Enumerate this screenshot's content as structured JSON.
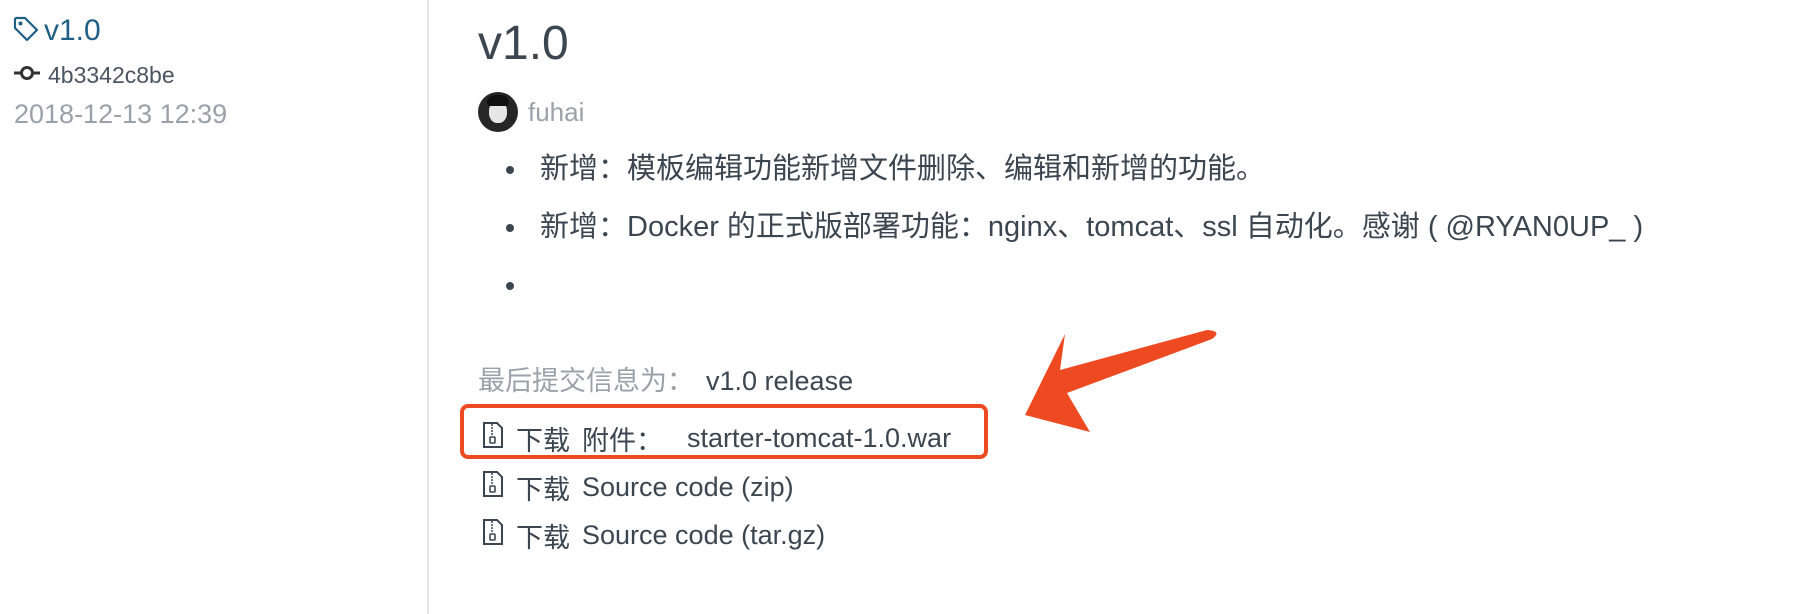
{
  "sidebar": {
    "tag": "v1.0",
    "commit_sha": "4b3342c8be",
    "date": "2018-12-13 12:39"
  },
  "release": {
    "title": "v1.0",
    "author": "fuhai",
    "notes": [
      "新增：模板编辑功能新增文件删除、编辑和新增的功能。",
      "新增：Docker 的正式版部署功能：nginx、tomcat、ssl 自动化。感谢 ( @RYAN0UP_ )",
      ""
    ],
    "last_commit_label": "最后提交信息为：",
    "last_commit_message": "v1.0 release",
    "downloads": [
      {
        "prefix": "下载",
        "label": "附件：",
        "file": "starter-tomcat-1.0.war"
      },
      {
        "prefix": "下载",
        "label": "Source code (zip)"
      },
      {
        "prefix": "下载",
        "label": "Source code (tar.gz)"
      }
    ]
  },
  "annotation": {
    "color": "#ee4a22"
  },
  "colors": {
    "link": "#1f5f86",
    "text": "#3c4650",
    "muted": "#9aa1a8"
  },
  "icons": [
    "tag-icon",
    "commit-icon",
    "file-zip-icon",
    "red-arrow-annotation"
  ]
}
